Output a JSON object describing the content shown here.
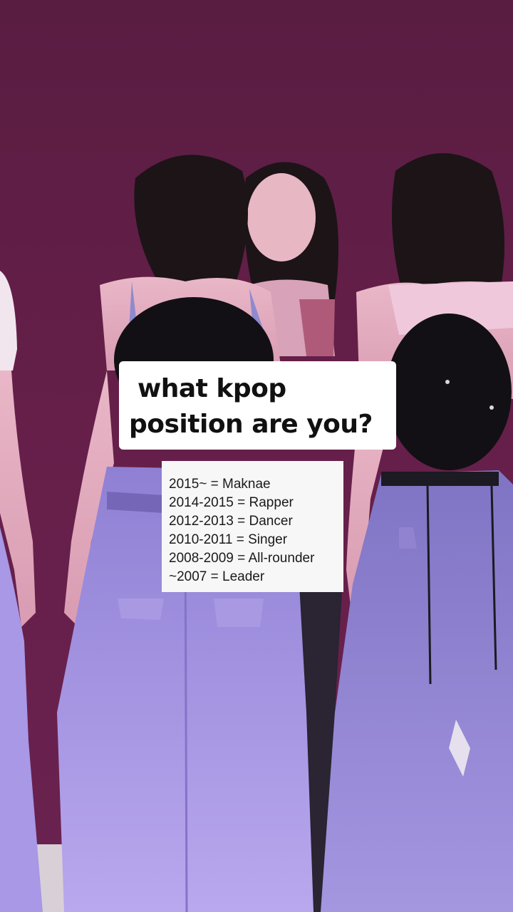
{
  "title": {
    "line1": "what kpop",
    "line2": "position are you?"
  },
  "positions": [
    "2015~ = Maknae",
    "2014-2015 = Rapper",
    "2012-2013 = Dancer",
    "2010-2011 = Singer",
    "2008-2009 = All-rounder",
    "~2007 = Leader"
  ],
  "colors": {
    "backdrop": "#5e1f45",
    "jeans": "#9a8ad8",
    "hat": "#121014",
    "hair": "#1c1417",
    "card": "#ffffff"
  }
}
